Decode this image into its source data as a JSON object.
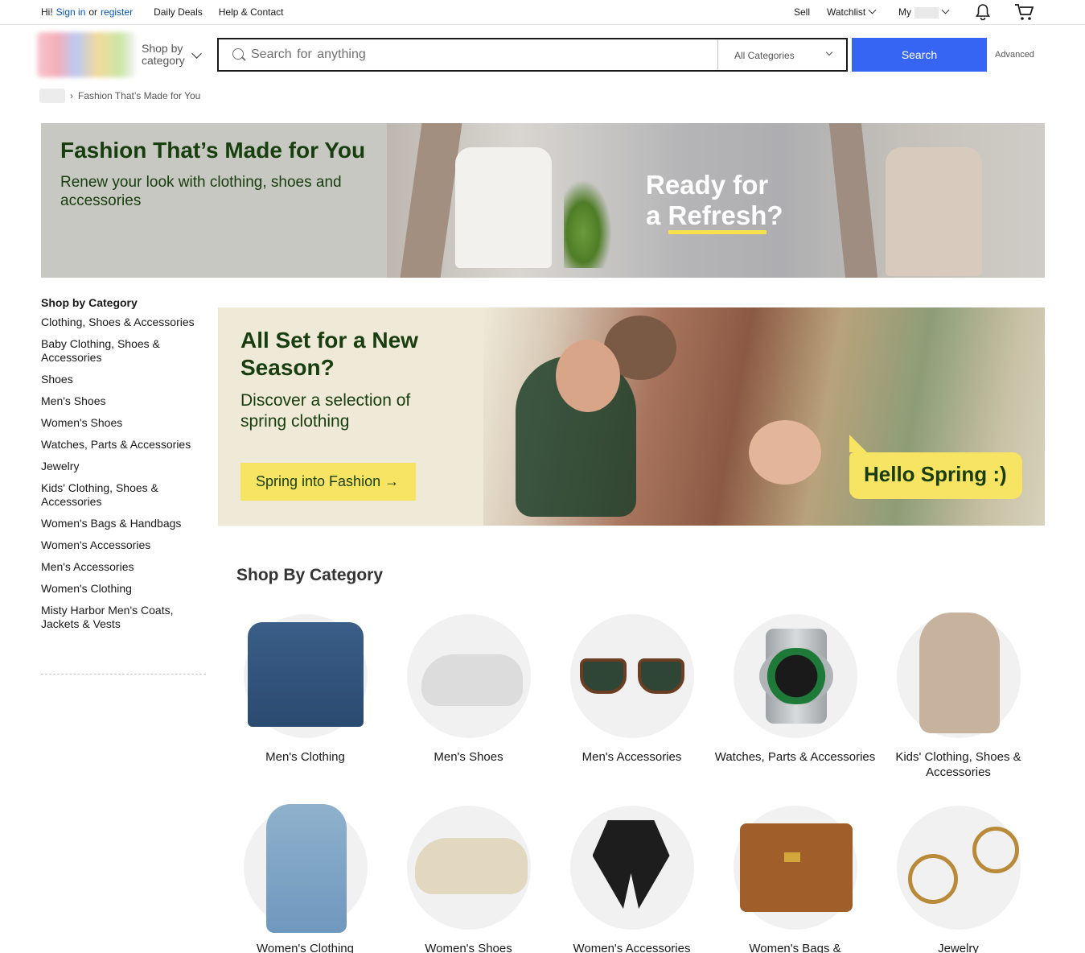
{
  "topbar": {
    "greeting": "Hi!",
    "sign_in": "Sign in",
    "or": "or",
    "register": "register",
    "daily_deals": "Daily Deals",
    "help_contact": "Help & Contact",
    "sell": "Sell",
    "watchlist": "Watchlist",
    "my": "My"
  },
  "header": {
    "shop_by_category": "Shop by category",
    "search_placeholder": "Search for anything",
    "category_select": "All Categories",
    "search_button": "Search",
    "advanced": "Advanced"
  },
  "breadcrumb": {
    "current": "Fashion That’s Made for You"
  },
  "hero": {
    "title": "Fashion That’s Made for You",
    "subtitle": "Renew your look with clothing, shoes and accessories",
    "image_text_line1": "Ready for",
    "image_text_line2_a": "a ",
    "image_text_line2_b": "Refresh",
    "image_text_line2_c": "?"
  },
  "sidenav": {
    "title": "Shop by Category",
    "items": [
      "Clothing, Shoes & Accessories",
      "Baby Clothing, Shoes & Accessories",
      "Shoes",
      "Men's Shoes",
      "Women's Shoes",
      "Watches, Parts & Accessories",
      "Jewelry",
      "Kids' Clothing, Shoes & Accessories",
      "Women's Bags & Handbags",
      "Women's Accessories",
      "Men's Accessories",
      "Women's Clothing",
      "Misty Harbor Men's Coats, Jackets & Vests"
    ]
  },
  "promo": {
    "title": "All Set for a New Season?",
    "subtitle": "Discover a selection of spring clothing",
    "cta": "Spring into Fashion →",
    "bubble": "Hello Spring :)"
  },
  "categories": {
    "heading": "Shop By Category",
    "items": [
      {
        "label": "Men's Clothing",
        "icon": "denim-jacket-image"
      },
      {
        "label": "Men's Shoes",
        "icon": "sneaker-image"
      },
      {
        "label": "Men's Accessories",
        "icon": "sunglasses-image"
      },
      {
        "label": "Watches, Parts & Accessories",
        "icon": "wristwatch-image"
      },
      {
        "label": "Kids' Clothing, Shoes & Accessories",
        "icon": "knit-romper-image"
      },
      {
        "label": "Women's Clothing",
        "icon": "floral-dress-image"
      },
      {
        "label": "Women's Shoes",
        "icon": "chunky-sneaker-image"
      },
      {
        "label": "Women's Accessories",
        "icon": "silk-scarf-image"
      },
      {
        "label": "Women's Bags &",
        "icon": "leather-handbag-image"
      },
      {
        "label": "Jewelry",
        "icon": "hoop-earrings-image"
      }
    ]
  },
  "colors": {
    "accent_blue": "#3665f3",
    "link_blue": "#0654ba",
    "brand_green_text": "#183d0e",
    "highlight_yellow": "#f7e463"
  }
}
